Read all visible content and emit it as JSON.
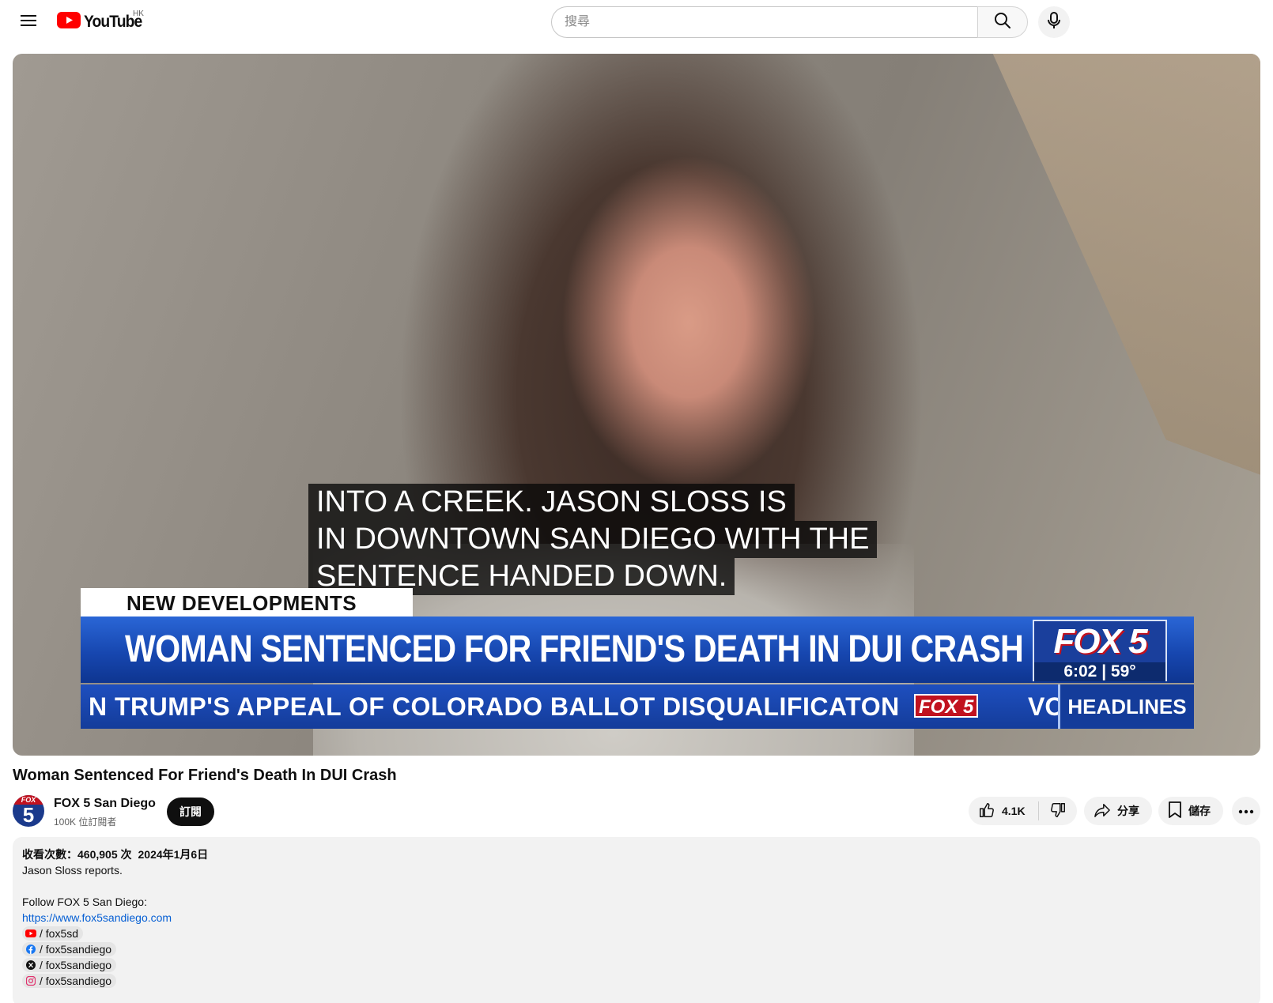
{
  "masthead": {
    "logo_text": "YouTube",
    "region": "HK",
    "search_placeholder": "搜尋"
  },
  "player": {
    "captions": [
      "INTO A CREEK. JASON SLOSS IS",
      "IN DOWNTOWN SAN DIEGO WITH THE",
      "SENTENCE HANDED DOWN."
    ],
    "lower_third": {
      "tag": "NEW DEVELOPMENTS",
      "headline": "WOMAN SENTENCED FOR FRIEND'S DEATH IN DUI CRASH",
      "badge_logo": "FOX 5",
      "badge_time": "6:02 | 59°",
      "ticker": "N TRUMP'S APPEAL OF COLORADO BALLOT DISQUALIFICATON",
      "ticker_logo": "FOX 5",
      "ticker_tail": "VOT",
      "ticker_section": "HEADLINES"
    }
  },
  "video": {
    "title": "Woman Sentenced For Friend's Death In DUI Crash"
  },
  "owner": {
    "avatar_top": "FOX",
    "avatar_num": "5",
    "name": "FOX 5 San Diego",
    "subscribers": "100K 位訂閱者",
    "subscribe_label": "訂閱"
  },
  "actions": {
    "like_count": "4.1K",
    "share_label": "分享",
    "save_label": "儲存"
  },
  "description": {
    "views": "收看次數：460,905 次",
    "date": "2024年1月6日",
    "lines": [
      "Jason Sloss reports.",
      "",
      "Follow FOX 5 San Diego:"
    ],
    "website": "https://www.fox5sandiego.com",
    "socials": [
      {
        "icon": "youtube-icon",
        "handle": "/ fox5sd",
        "color": "#ff0000"
      },
      {
        "icon": "facebook-icon",
        "handle": "/ fox5sandiego",
        "color": "#1877f2"
      },
      {
        "icon": "x-icon",
        "handle": "/ fox5sandiego",
        "color": "#0f0f0f"
      },
      {
        "icon": "instagram-icon",
        "handle": "/ fox5sandiego",
        "color": "#e1306c"
      }
    ]
  },
  "colors": {
    "youtube_red": "#ff0000",
    "link_blue": "#065fd4",
    "chip_bg": "#f2f2f2",
    "fox_blue": "#1747b0"
  }
}
